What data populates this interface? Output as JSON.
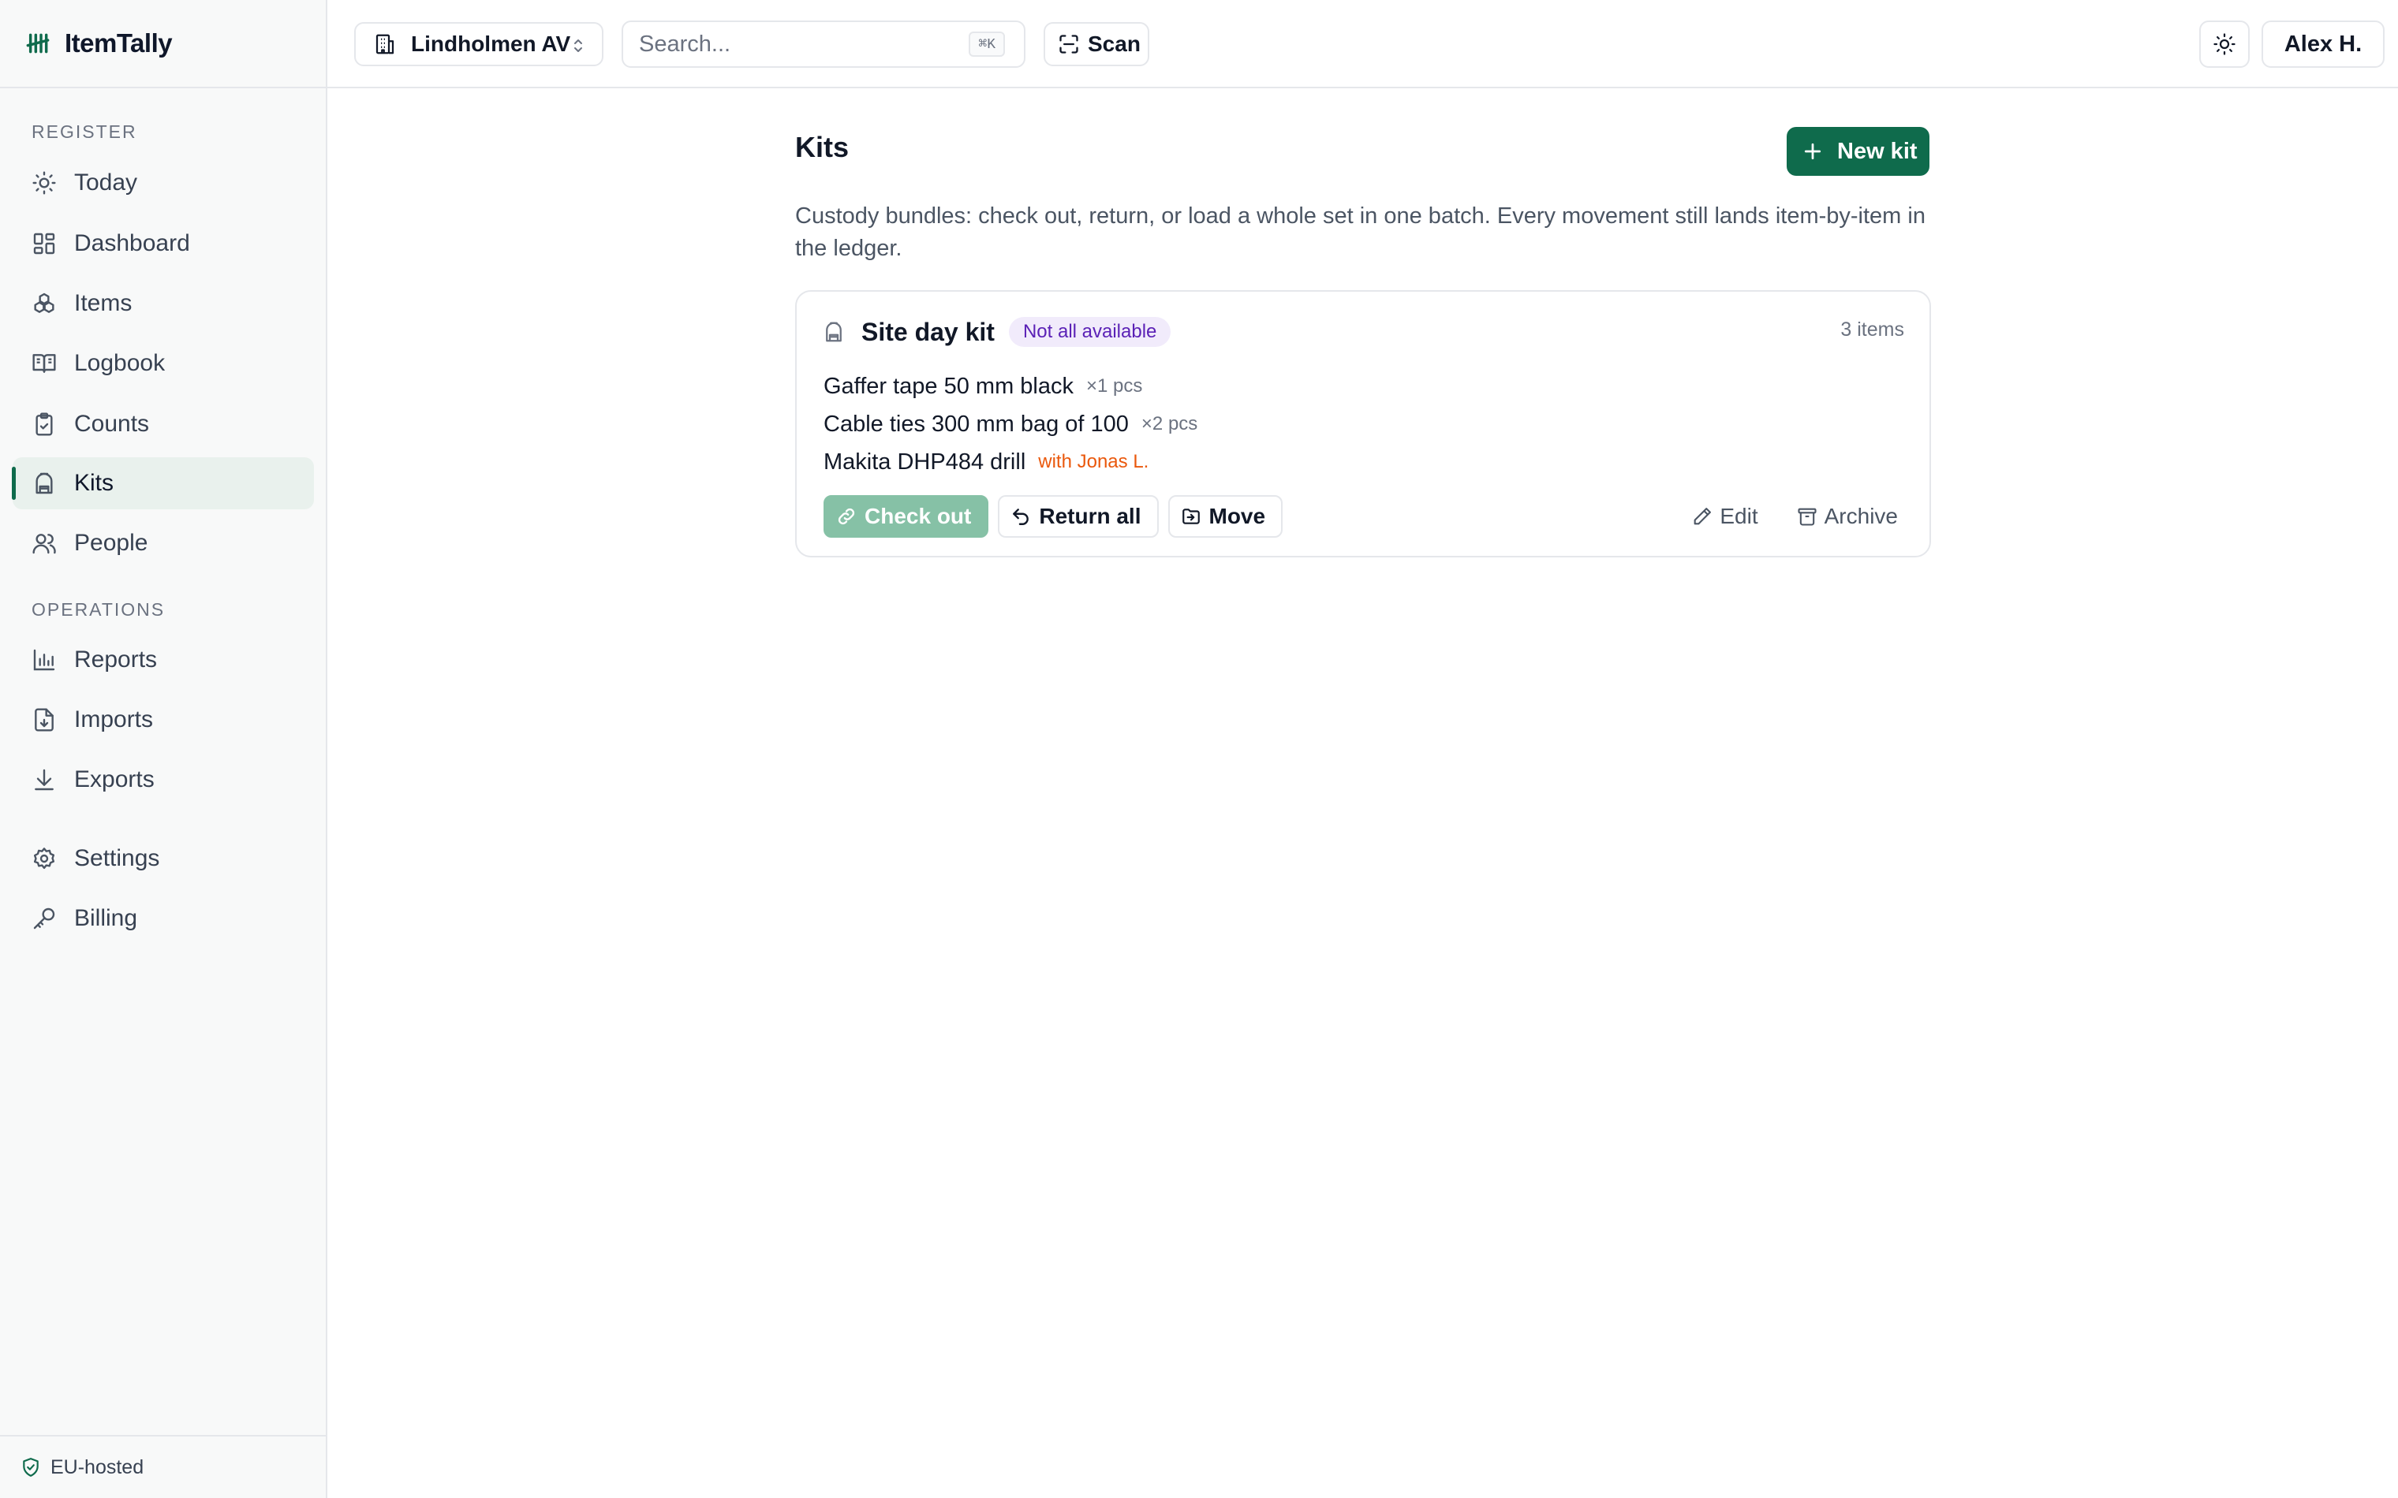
{
  "app": {
    "name": "ItemTally"
  },
  "sidebar": {
    "sections": [
      {
        "label": "REGISTER"
      },
      {
        "label": "OPERATIONS"
      }
    ],
    "items": [
      {
        "label": "Today",
        "icon": "sun-icon"
      },
      {
        "label": "Dashboard",
        "icon": "dashboard-icon"
      },
      {
        "label": "Items",
        "icon": "boxes-icon"
      },
      {
        "label": "Logbook",
        "icon": "book-icon"
      },
      {
        "label": "Counts",
        "icon": "clipboard-check-icon"
      },
      {
        "label": "Kits",
        "icon": "backpack-icon",
        "active": true
      },
      {
        "label": "People",
        "icon": "users-icon"
      },
      {
        "label": "Reports",
        "icon": "bar-chart-icon"
      },
      {
        "label": "Imports",
        "icon": "file-import-icon"
      },
      {
        "label": "Exports",
        "icon": "download-icon"
      },
      {
        "label": "Settings",
        "icon": "gear-icon"
      },
      {
        "label": "Billing",
        "icon": "key-icon"
      }
    ],
    "footer": {
      "label": "EU-hosted",
      "icon": "shield-check-icon"
    }
  },
  "topbar": {
    "workspace": "Lindholmen AV",
    "search": {
      "placeholder": "Search...",
      "value": "",
      "shortcut": "⌘K"
    },
    "scan_label": "Scan",
    "user_label": "Alex H."
  },
  "page": {
    "title": "Kits",
    "new_button_label": "New kit",
    "description": "Custody bundles: check out, return, or load a whole set in one batch. Every movement still lands item-by-item in the ledger."
  },
  "kit": {
    "name": "Site day kit",
    "badge": "Not all available",
    "count": "3 items",
    "items": [
      {
        "name": "Gaffer tape 50 mm black",
        "qty": "×1 pcs"
      },
      {
        "name": "Cable ties 300 mm bag of 100",
        "qty": "×2 pcs"
      },
      {
        "name": "Makita DHP484 drill",
        "custody": "with Jonas L."
      }
    ],
    "actions": {
      "checkout": "Check out",
      "return_all": "Return all",
      "move": "Move",
      "edit": "Edit",
      "archive": "Archive"
    }
  },
  "colors": {
    "brand": "#0f6b4c",
    "badge_bg": "#f1ebfb",
    "badge_text": "#5b21b6",
    "custody": "#ea580c",
    "checkout_disabled": "#86c1a6"
  }
}
